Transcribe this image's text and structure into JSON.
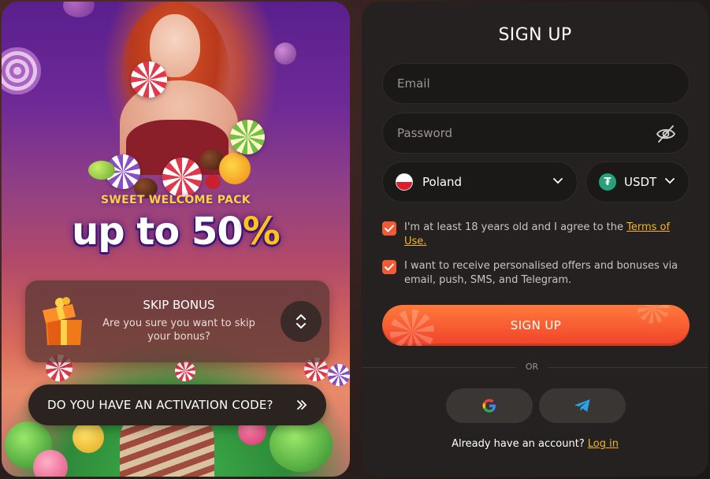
{
  "promo": {
    "subtitle": "SWEET WELCOME PACK",
    "title_prefix": "up to 50",
    "title_suffix": "%",
    "skip_bonus": {
      "title": "SKIP BONUS",
      "text": "Are you sure you want to skip your bonus?"
    },
    "activation_label": "DO YOU HAVE AN ACTIVATION CODE?"
  },
  "form": {
    "title": "SIGN UP",
    "email_placeholder": "Email",
    "password_placeholder": "Password",
    "country": {
      "selected": "Poland",
      "flag_icon": "poland-flag-icon"
    },
    "currency": {
      "selected": "USDT",
      "icon": "tether-icon"
    },
    "age_consent": {
      "checked": true,
      "text": "I'm at least 18 years old and I agree to the ",
      "link": "Terms of Use."
    },
    "marketing_consent": {
      "checked": true,
      "text": "I want to receive personalised offers and bonuses via email, push, SMS, and Telegram."
    },
    "submit_label": "SIGN UP",
    "divider_label": "OR",
    "social": [
      {
        "name": "Google",
        "icon": "google-icon"
      },
      {
        "name": "Telegram",
        "icon": "telegram-icon"
      }
    ],
    "login_prompt": "Already have an account?",
    "login_link": "Log in"
  },
  "colors": {
    "accent": "#f05a34",
    "link": "#f3b526",
    "panel_bg": "#242120",
    "field_bg": "#1b1918",
    "promo_gradient_top": "#5a1f8e",
    "promo_gradient_bottom": "#e88a6a"
  }
}
